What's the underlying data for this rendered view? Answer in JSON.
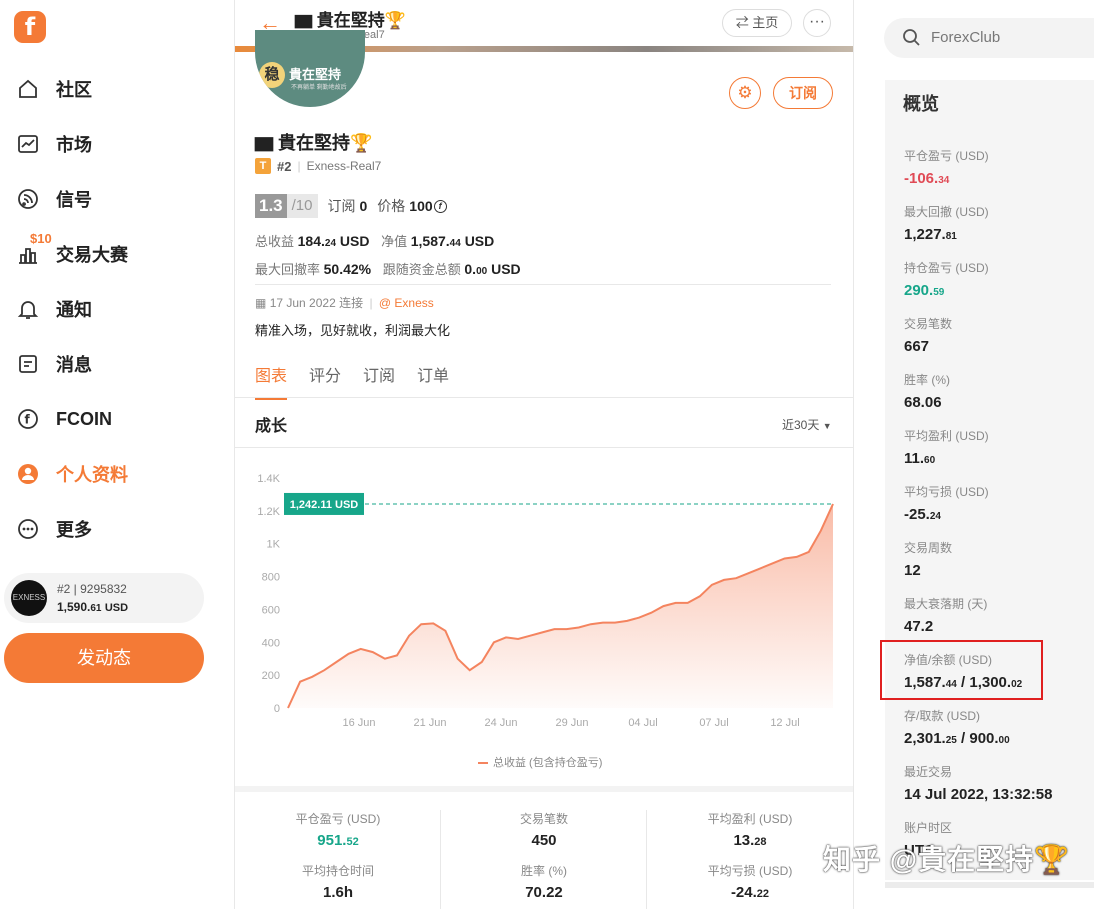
{
  "sidebar": {
    "logo": "f",
    "items": [
      {
        "label": "社区",
        "icon": "home-icon"
      },
      {
        "label": "市场",
        "icon": "chart-icon"
      },
      {
        "label": "信号",
        "icon": "signal-icon"
      },
      {
        "label": "交易大赛",
        "icon": "contest-icon"
      },
      {
        "label": "通知",
        "icon": "bell-icon"
      },
      {
        "label": "消息",
        "icon": "message-icon"
      },
      {
        "label": "FCOIN",
        "icon": "fcoin-icon"
      },
      {
        "label": "个人资料",
        "icon": "profile-icon"
      },
      {
        "label": "更多",
        "icon": "more-icon"
      }
    ],
    "contest_badge": "$10",
    "account": {
      "rank_id": "#2 | 9295832",
      "balance_int": "1,590.",
      "balance_dec": "61",
      "currency": "USD",
      "avatar_text": "EXNESS"
    },
    "post_button": "发动态"
  },
  "header": {
    "title": "▆ 貴在堅持🏆",
    "subtitle": "#2 | Exness-Real7",
    "home_button": "⇄ 主页",
    "more_button": "···"
  },
  "profile": {
    "avatar_seal": "稳",
    "avatar_name": "貴在堅持",
    "avatar_small": "不再躺单  剩勤地故后",
    "subscribe_button": "订阅",
    "name": "▆ 貴在堅持🏆",
    "badge": "T",
    "rank": "#2",
    "account": "Exness-Real7",
    "score": "1.3",
    "score_den": "/10",
    "subs_label": "订阅",
    "subs_value": "0",
    "price_label": "价格",
    "price_value": "100",
    "total_profit_label": "总收益",
    "total_profit_int": "184.",
    "total_profit_dec": "24",
    "equity_label": "净值",
    "equity_int": "1,587.",
    "equity_dec": "44",
    "currency": "USD",
    "max_dd_label": "最大回撤率",
    "max_dd_value": "50.42%",
    "follow_label": "跟随资金总额",
    "follow_int": "0.",
    "follow_dec": "00",
    "since": "17 Jun 2022 连接",
    "broker": "@ Exness",
    "description": "精准入场，见好就收，利润最大化"
  },
  "tabs": [
    "图表",
    "评分",
    "订阅",
    "订单"
  ],
  "growth": {
    "title": "成长",
    "range": "近30天",
    "legend": "总收益 (包含持仓盈亏)"
  },
  "chart_data": {
    "type": "area",
    "x_ticks": [
      "16 Jun",
      "21 Jun",
      "24 Jun",
      "29 Jun",
      "04 Jul",
      "07 Jul",
      "12 Jul"
    ],
    "y_ticks": [
      "0",
      "200",
      "400",
      "600",
      "800",
      "1K",
      "1.2K",
      "1.4K"
    ],
    "ylim": [
      0,
      1400
    ],
    "last_value_label": "1,242.11 USD",
    "series": [
      {
        "name": "总收益 (包含持仓盈亏)",
        "values": [
          0,
          160,
          190,
          230,
          280,
          330,
          360,
          340,
          300,
          320,
          440,
          510,
          515,
          470,
          300,
          230,
          280,
          400,
          430,
          420,
          440,
          460,
          480,
          480,
          490,
          510,
          520,
          520,
          530,
          550,
          580,
          620,
          640,
          640,
          680,
          750,
          780,
          790,
          820,
          850,
          880,
          910,
          920,
          950,
          1080,
          1242
        ]
      }
    ],
    "color": "#f4845f"
  },
  "stats": [
    {
      "label": "平仓盈亏 (USD)",
      "int": "951.",
      "dec": "52",
      "green": true
    },
    {
      "label": "交易笔数",
      "int": "450",
      "dec": ""
    },
    {
      "label": "平均盈利 (USD)",
      "int": "13.",
      "dec": "28"
    },
    {
      "label": "平均持仓时间",
      "int": "1.6h",
      "dec": ""
    },
    {
      "label": "胜率 (%)",
      "int": "70.22",
      "dec": ""
    },
    {
      "label": "平均亏损 (USD)",
      "int": "-24.",
      "dec": "22"
    }
  ],
  "search": {
    "placeholder": "ForexClub"
  },
  "overview": {
    "title": "概览",
    "items": [
      {
        "label": "平仓盈亏 (USD)",
        "int": "-106.",
        "dec": "34",
        "color": "red"
      },
      {
        "label": "最大回撤 (USD)",
        "int": "1,227.",
        "dec": "81"
      },
      {
        "label": "持仓盈亏 (USD)",
        "int": "290.",
        "dec": "59",
        "color": "green"
      },
      {
        "label": "交易笔数",
        "int": "667",
        "dec": ""
      },
      {
        "label": "胜率 (%)",
        "int": "68.06",
        "dec": ""
      },
      {
        "label": "平均盈利 (USD)",
        "int": "11.",
        "dec": "60"
      },
      {
        "label": "平均亏损 (USD)",
        "int": "-25.",
        "dec": "24"
      },
      {
        "label": "交易周数",
        "int": "12",
        "dec": ""
      },
      {
        "label": "最大衰落期 (天)",
        "int": "47.2",
        "dec": ""
      },
      {
        "label": "净值/余额 (USD)",
        "int": "1,587.",
        "dec": "44",
        "int2": " / 1,300.",
        "dec2": "02"
      },
      {
        "label": "存/取款 (USD)",
        "int": "2,301.",
        "dec": "25",
        "int2": " / 900.",
        "dec2": "00"
      },
      {
        "label": "最近交易",
        "int": "14 Jul 2022, 13:32:58",
        "dec": ""
      },
      {
        "label": "账户时区",
        "int": "UTC",
        "dec": ""
      }
    ]
  },
  "watermark": "知乎 @貴在堅持🏆"
}
